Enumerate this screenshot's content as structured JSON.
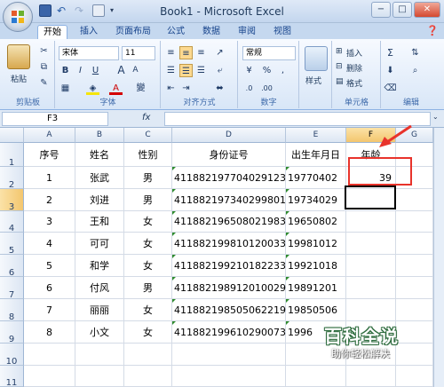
{
  "window": {
    "title": "Book1 - Microsoft Excel",
    "min": "−",
    "max": "□",
    "close": "✕"
  },
  "tabs": [
    "开始",
    "插入",
    "页面布局",
    "公式",
    "数据",
    "审阅",
    "视图"
  ],
  "ribbon": {
    "clipboard": {
      "paste": "粘贴",
      "label": "剪贴板"
    },
    "font": {
      "name": "宋体",
      "size": "11",
      "bold": "B",
      "italic": "I",
      "underline": "U",
      "grow": "A",
      "shrink": "A",
      "fontcolor": "A",
      "wen": "變",
      "label": "字体"
    },
    "align": {
      "label": "对齐方式"
    },
    "number": {
      "format": "常规",
      "percent": "%",
      "comma": ",",
      "label": "数字"
    },
    "styles": {
      "btn": "样式"
    },
    "cells": {
      "insert": "插入",
      "delete": "删除",
      "format": "格式",
      "label": "单元格"
    },
    "editing": {
      "sigma": "Σ",
      "label": "编辑"
    }
  },
  "formula": {
    "namebox": "F3",
    "fx": "fx",
    "value": ""
  },
  "columns": [
    "A",
    "B",
    "C",
    "D",
    "E",
    "F",
    "G"
  ],
  "rows": [
    "1",
    "2",
    "3",
    "4",
    "5",
    "6",
    "7",
    "8",
    "9",
    "10",
    "11"
  ],
  "headers": {
    "a": "序号",
    "b": "姓名",
    "c": "性别",
    "d": "身份证号",
    "e": "出生年月日",
    "f": "年龄"
  },
  "records": [
    {
      "a": "1",
      "b": "张武",
      "c": "男",
      "d": "411882197704029123",
      "e": "19770402",
      "f": "39"
    },
    {
      "a": "2",
      "b": "刘进",
      "c": "男",
      "d": "411882197340299801",
      "e": "19734029",
      "f": ""
    },
    {
      "a": "3",
      "b": "王和",
      "c": "女",
      "d": "411882196508021983",
      "e": "19650802",
      "f": ""
    },
    {
      "a": "4",
      "b": "可可",
      "c": "女",
      "d": "411882199810120033",
      "e": "19981012",
      "f": ""
    },
    {
      "a": "5",
      "b": "和学",
      "c": "女",
      "d": "411882199210182233",
      "e": "19921018",
      "f": ""
    },
    {
      "a": "6",
      "b": "付风",
      "c": "男",
      "d": "411882198912010029",
      "e": "19891201",
      "f": ""
    },
    {
      "a": "7",
      "b": "丽丽",
      "c": "女",
      "d": "411882198505062219",
      "e": "19850506",
      "f": ""
    },
    {
      "a": "8",
      "b": "小文",
      "c": "女",
      "d": "411882199610290073",
      "e": "1996",
      "f": ""
    }
  ],
  "watermark": {
    "main": "百科全说",
    "sub": "助你轻松解决"
  },
  "colors": {
    "annotation": "#e8332b",
    "ribbon": "#dbe7f6"
  }
}
